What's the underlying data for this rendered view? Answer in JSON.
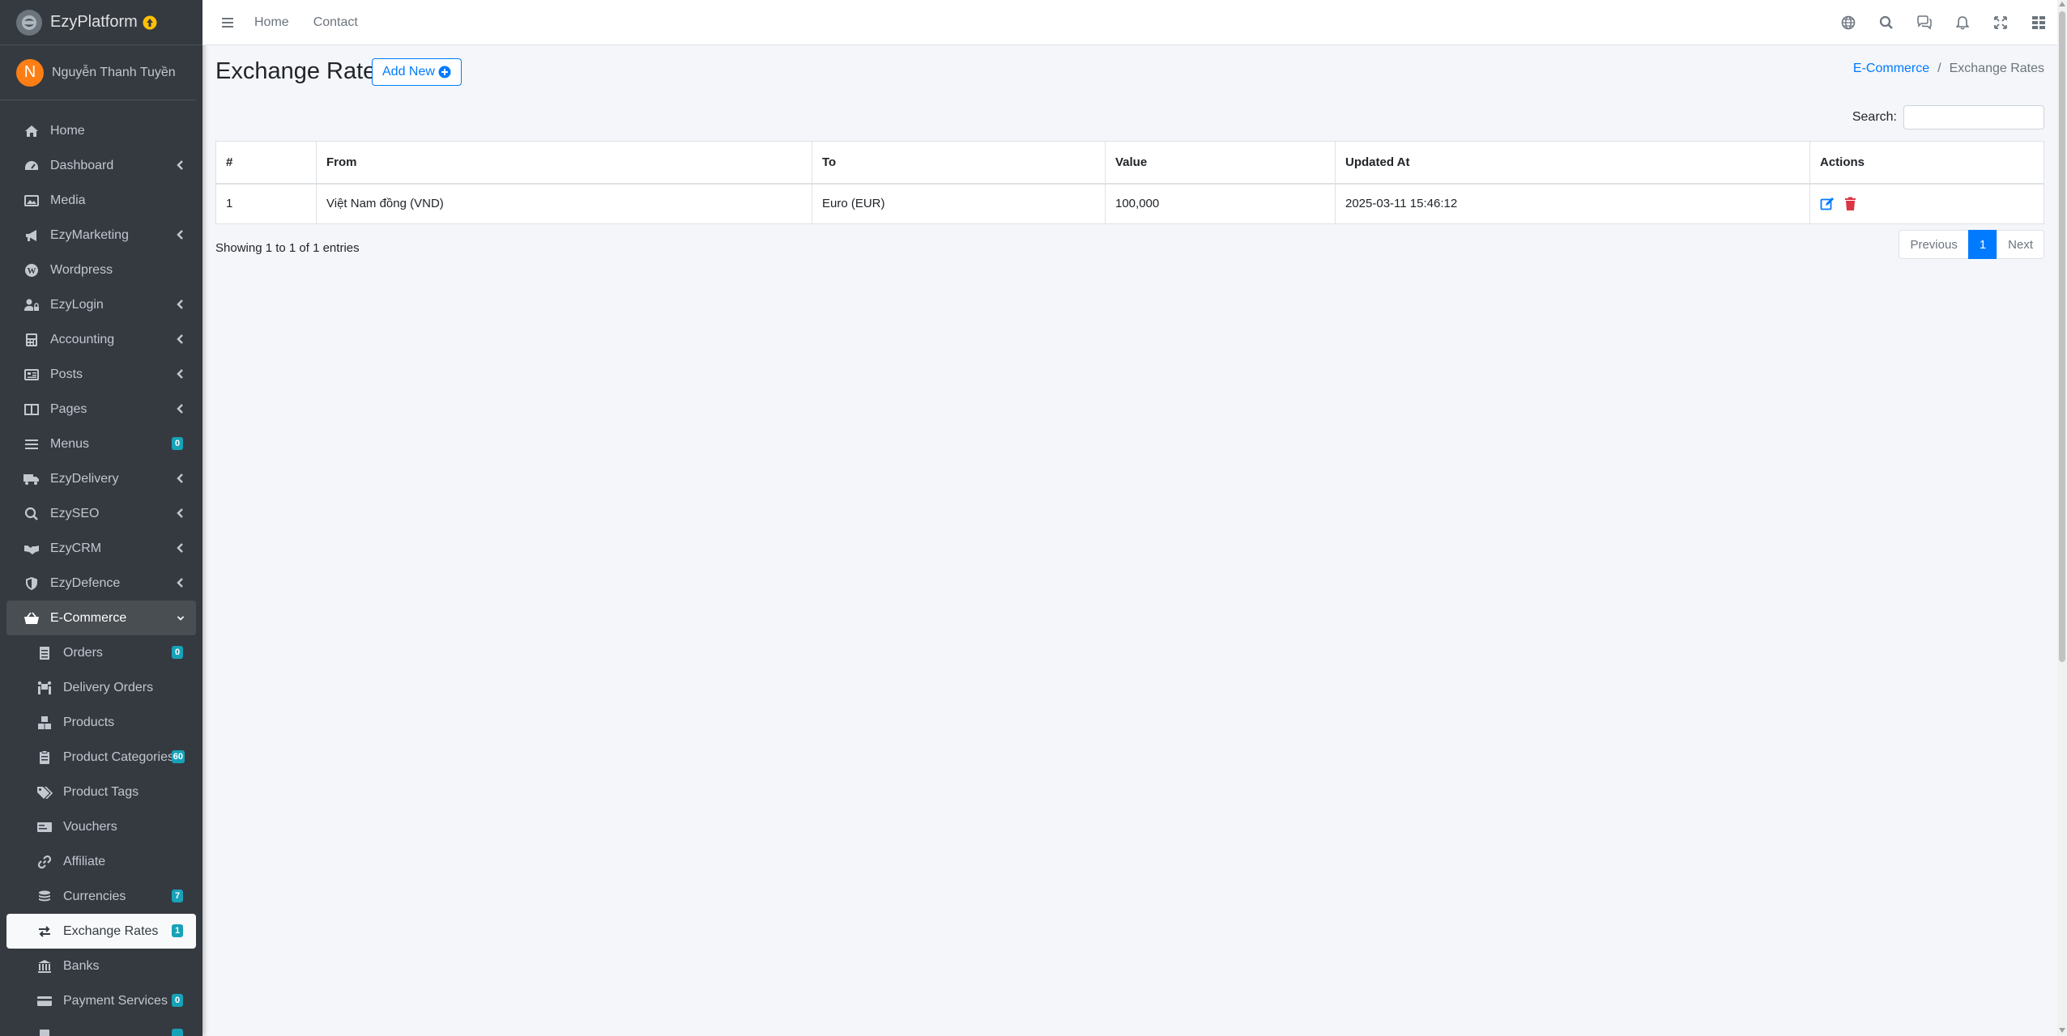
{
  "brand": {
    "name": "EzyPlatform"
  },
  "user": {
    "initial": "N",
    "name": "Nguyễn Thanh Tuyền"
  },
  "topnav": {
    "home": "Home",
    "contact": "Contact"
  },
  "sidebar": {
    "items": [
      {
        "label": "Home"
      },
      {
        "label": "Dashboard"
      },
      {
        "label": "Media"
      },
      {
        "label": "EzyMarketing"
      },
      {
        "label": "Wordpress"
      },
      {
        "label": "EzyLogin"
      },
      {
        "label": "Accounting"
      },
      {
        "label": "Posts"
      },
      {
        "label": "Pages"
      },
      {
        "label": "Menus",
        "badge": "0"
      },
      {
        "label": "EzyDelivery"
      },
      {
        "label": "EzySEO"
      },
      {
        "label": "EzyCRM"
      },
      {
        "label": "EzyDefence"
      },
      {
        "label": "E-Commerce"
      }
    ],
    "sub_items": [
      {
        "label": "Orders",
        "badge": "0"
      },
      {
        "label": "Delivery Orders"
      },
      {
        "label": "Products"
      },
      {
        "label": "Product Categories",
        "badge": "60"
      },
      {
        "label": "Product Tags"
      },
      {
        "label": "Vouchers"
      },
      {
        "label": "Affiliate"
      },
      {
        "label": "Currencies",
        "badge": "7"
      },
      {
        "label": "Exchange Rates",
        "badge": "1"
      },
      {
        "label": "Banks"
      },
      {
        "label": "Payment Services",
        "badge": "0"
      }
    ]
  },
  "page": {
    "title": "Exchange Rates",
    "add_new": "Add New",
    "breadcrumb": {
      "parent": "E-Commerce",
      "separator": "/",
      "current": "Exchange Rates"
    },
    "search_label": "Search:",
    "search_value": ""
  },
  "table": {
    "columns": [
      "#",
      "From",
      "To",
      "Value",
      "Updated At",
      "Actions"
    ],
    "rows": [
      {
        "num": "1",
        "from": "Việt Nam đồng (VND)",
        "to": "Euro (EUR)",
        "value": "100,000",
        "updated_at": "2025-03-11 15:46:12"
      }
    ]
  },
  "pagination": {
    "info": "Showing 1 to 1 of 1 entries",
    "previous": "Previous",
    "current": "1",
    "next": "Next"
  },
  "colors": {
    "sidebar_bg": "#343a40",
    "primary": "#007bff",
    "badge": "#17a2b8",
    "danger": "#dc3545"
  }
}
